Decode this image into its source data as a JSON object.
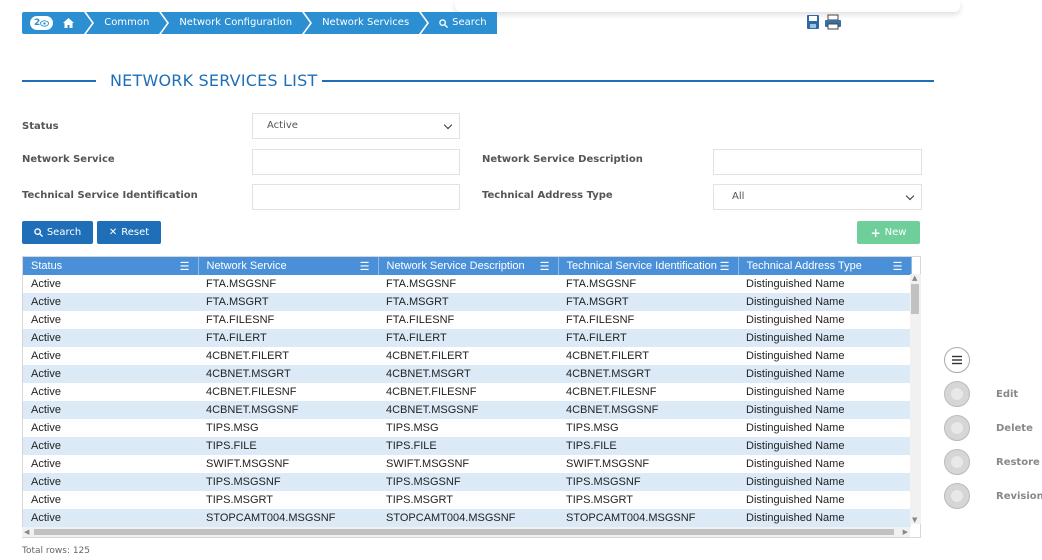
{
  "breadcrumb": {
    "badge": "2",
    "items": [
      "Common",
      "Network Configuration",
      "Network Services",
      "Search"
    ]
  },
  "page_title": "NETWORK SERVICES LIST",
  "form": {
    "status_label": "Status",
    "status_value": "Active",
    "network_service_label": "Network Service",
    "network_service_value": "",
    "description_label": "Network Service Description",
    "description_value": "",
    "tech_id_label": "Technical Service Identification",
    "tech_id_value": "",
    "address_type_label": "Technical Address Type",
    "address_type_value": "All"
  },
  "buttons": {
    "search": "Search",
    "reset": "Reset",
    "new": "New"
  },
  "table": {
    "columns": [
      "Status",
      "Network Service",
      "Network Service Description",
      "Technical Service Identification",
      "Technical Address Type"
    ],
    "rows": [
      [
        "Active",
        "FTA.MSGSNF",
        "FTA.MSGSNF",
        "FTA.MSGSNF",
        "Distinguished Name"
      ],
      [
        "Active",
        "FTA.MSGRT",
        "FTA.MSGRT",
        "FTA.MSGRT",
        "Distinguished Name"
      ],
      [
        "Active",
        "FTA.FILESNF",
        "FTA.FILESNF",
        "FTA.FILESNF",
        "Distinguished Name"
      ],
      [
        "Active",
        "FTA.FILERT",
        "FTA.FILERT",
        "FTA.FILERT",
        "Distinguished Name"
      ],
      [
        "Active",
        "4CBNET.FILERT",
        "4CBNET.FILERT",
        "4CBNET.FILERT",
        "Distinguished Name"
      ],
      [
        "Active",
        "4CBNET.MSGRT",
        "4CBNET.MSGRT",
        "4CBNET.MSGRT",
        "Distinguished Name"
      ],
      [
        "Active",
        "4CBNET.FILESNF",
        "4CBNET.FILESNF",
        "4CBNET.FILESNF",
        "Distinguished Name"
      ],
      [
        "Active",
        "4CBNET.MSGSNF",
        "4CBNET.MSGSNF",
        "4CBNET.MSGSNF",
        "Distinguished Name"
      ],
      [
        "Active",
        "TIPS.MSG",
        "TIPS.MSG",
        "TIPS.MSG",
        "Distinguished Name"
      ],
      [
        "Active",
        "TIPS.FILE",
        "TIPS.FILE",
        "TIPS.FILE",
        "Distinguished Name"
      ],
      [
        "Active",
        "SWIFT.MSGSNF",
        "SWIFT.MSGSNF",
        "SWIFT.MSGSNF",
        "Distinguished Name"
      ],
      [
        "Active",
        "TIPS.MSGSNF",
        "TIPS.MSGSNF",
        "TIPS.MSGSNF",
        "Distinguished Name"
      ],
      [
        "Active",
        "TIPS.MSGRT",
        "TIPS.MSGRT",
        "TIPS.MSGRT",
        "Distinguished Name"
      ],
      [
        "Active",
        "STOPCAMT004.MSGSNF",
        "STOPCAMT004.MSGSNF",
        "STOPCAMT004.MSGSNF",
        "Distinguished Name"
      ]
    ]
  },
  "total_rows": "Total rows: 125",
  "actions": {
    "edit": "Edit",
    "delete": "Delete",
    "restore": "Restore",
    "revisions": "Revisions"
  },
  "colors": {
    "primary": "#1e6fb8",
    "header": "#4a90d9",
    "row_alt": "#dce9f7",
    "new_button": "#6fcf9b"
  }
}
